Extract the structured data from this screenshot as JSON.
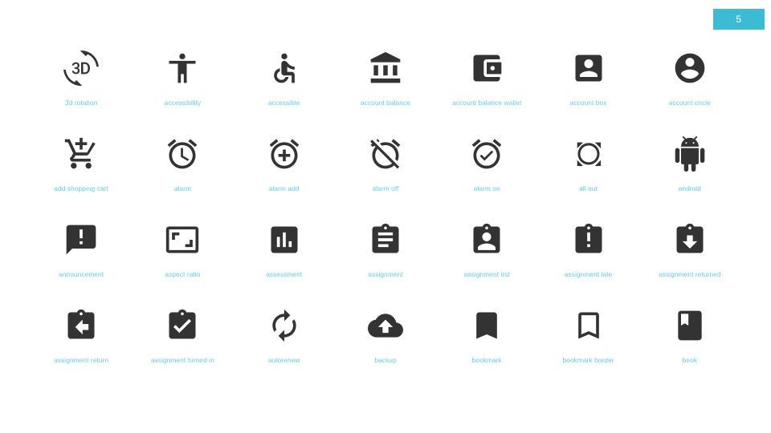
{
  "page": {
    "background_color": "#ffffff",
    "icon_color": "#333333",
    "label_color": "#63cdeb"
  },
  "badge": {
    "text": "5",
    "background_color": "#3cbcd4",
    "text_color": "#ffffff"
  },
  "grid": {
    "columns": 7,
    "rows": 4,
    "icons": [
      {
        "name": "3d-rotation-icon",
        "label": "3d rotation"
      },
      {
        "name": "accessibility-icon",
        "label": "accessibility"
      },
      {
        "name": "accessible-icon",
        "label": "accessible"
      },
      {
        "name": "account-balance-icon",
        "label": "account balance"
      },
      {
        "name": "account-balance-wallet-icon",
        "label": "account balance wallet"
      },
      {
        "name": "account-box-icon",
        "label": "account box"
      },
      {
        "name": "account-circle-icon",
        "label": "account circle"
      },
      {
        "name": "add-shopping-cart-icon",
        "label": "add shopping cart"
      },
      {
        "name": "alarm-icon",
        "label": "alarm"
      },
      {
        "name": "alarm-add-icon",
        "label": "alarm add"
      },
      {
        "name": "alarm-off-icon",
        "label": "alarm off"
      },
      {
        "name": "alarm-on-icon",
        "label": "alarm on"
      },
      {
        "name": "all-out-icon",
        "label": "all out"
      },
      {
        "name": "android-icon",
        "label": "android"
      },
      {
        "name": "announcement-icon",
        "label": "announcement"
      },
      {
        "name": "aspect-ratio-icon",
        "label": "aspect ratio"
      },
      {
        "name": "assessment-icon",
        "label": "assessment"
      },
      {
        "name": "assignment-icon",
        "label": "assignment"
      },
      {
        "name": "assignment-ind-icon",
        "label": "assignment ind"
      },
      {
        "name": "assignment-late-icon",
        "label": "assignment late"
      },
      {
        "name": "assignment-returned-icon",
        "label": "assignment returned"
      },
      {
        "name": "assignment-return-icon",
        "label": "assignment return"
      },
      {
        "name": "assignment-turned-in-icon",
        "label": "assignment turned in"
      },
      {
        "name": "autorenew-icon",
        "label": "autorenew"
      },
      {
        "name": "backup-icon",
        "label": "backup"
      },
      {
        "name": "bookmark-icon",
        "label": "bookmark"
      },
      {
        "name": "bookmark-border-icon",
        "label": "bookmark border"
      },
      {
        "name": "book-icon",
        "label": "book"
      }
    ]
  }
}
